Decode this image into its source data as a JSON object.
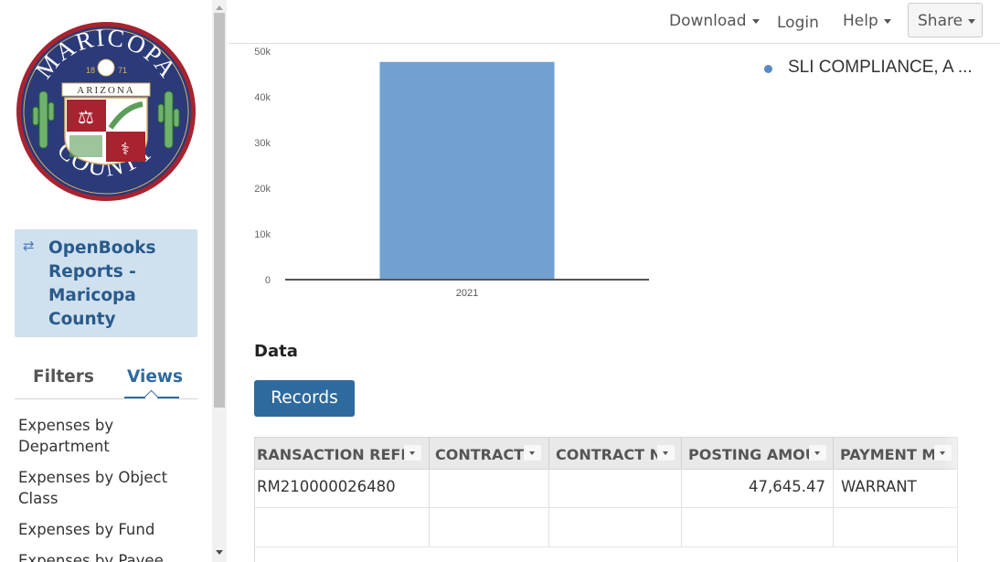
{
  "logo": {
    "top_text": "MARICOPA",
    "bottom_text": "COUNTY",
    "band_text": "ARIZONA",
    "year_left": "18",
    "year_right": "71",
    "colors": {
      "ring": "#2b3a78",
      "outer": "#a8232f",
      "gold": "#d7b26a"
    }
  },
  "dataset": {
    "icon": "swap-icon",
    "title": "OpenBooks Reports - Maricopa County"
  },
  "sidebar_tabs": {
    "filters": "Filters",
    "views": "Views",
    "active": "Views"
  },
  "views": [
    "Expenses by Department",
    "Expenses by Object Class",
    "Expenses by Fund",
    "Expenses by Payee"
  ],
  "topbar": {
    "download": "Download",
    "login": "Login",
    "help": "Help",
    "share": "Share"
  },
  "chart_data": {
    "type": "bar",
    "categories": [
      "2021"
    ],
    "series": [
      {
        "name": "SLI COMPLIANCE, A ...",
        "values": [
          47645.47
        ]
      }
    ],
    "y_ticks": [
      "0",
      "10k",
      "20k",
      "30k",
      "40k",
      "50k"
    ],
    "ylim": [
      0,
      50000
    ],
    "bar_color": "#72a1d0",
    "legend_placement": "top-right"
  },
  "data_section": {
    "heading": "Data",
    "records_button": "Records",
    "columns": [
      "RANSACTION REFE",
      "CONTRACT",
      "CONTRACT N",
      "POSTING AMOU",
      "PAYMENT M"
    ],
    "rows": [
      [
        "RM210000026480",
        "",
        "",
        "47,645.47",
        "WARRANT"
      ],
      [
        "",
        "",
        "",
        "",
        ""
      ]
    ]
  }
}
